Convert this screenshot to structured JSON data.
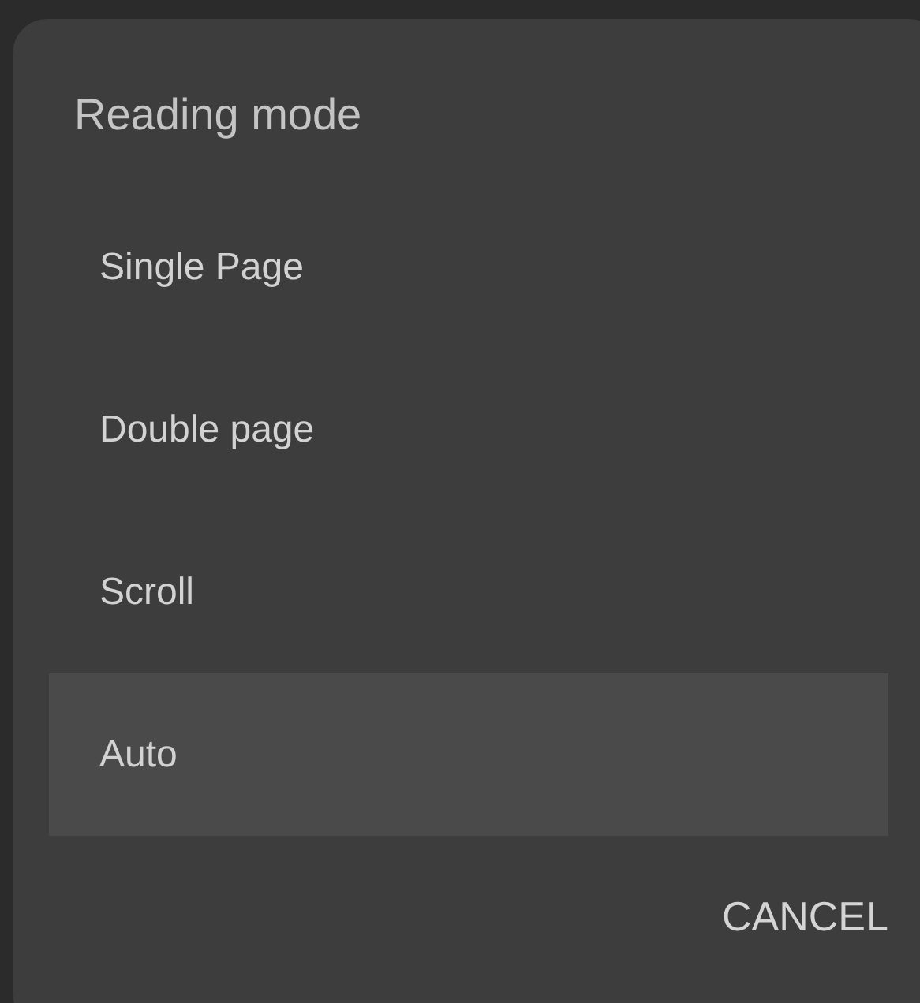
{
  "dialog": {
    "title": "Reading mode",
    "options": [
      {
        "label": "Single Page",
        "selected": false
      },
      {
        "label": "Double page",
        "selected": false
      },
      {
        "label": "Scroll",
        "selected": false
      },
      {
        "label": "Auto",
        "selected": true
      }
    ],
    "buttons": [
      "CANCEL"
    ]
  }
}
